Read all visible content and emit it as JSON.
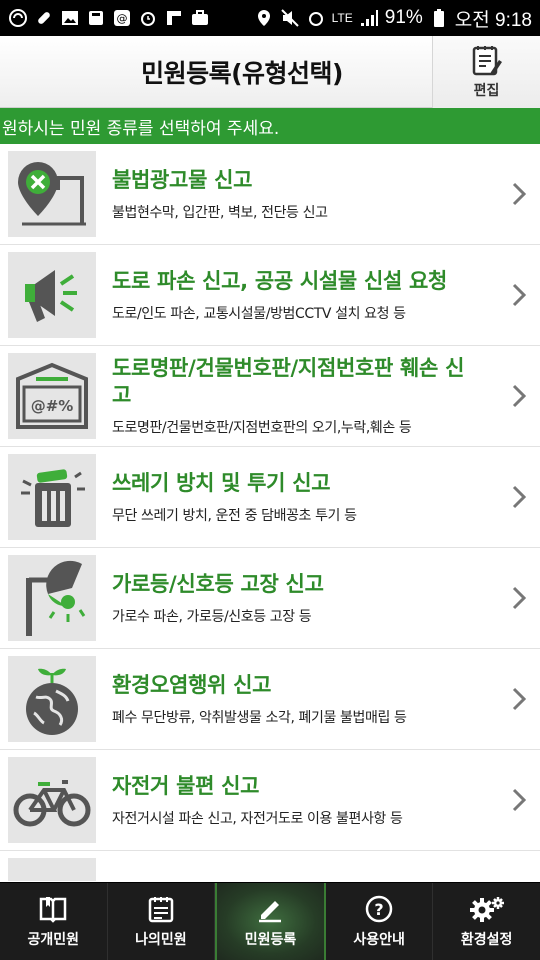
{
  "status_bar": {
    "battery": "91%",
    "time": "오전 9:18",
    "network": "LTE"
  },
  "header": {
    "title": "민원등록(유형선택)",
    "edit_label": "편집"
  },
  "banner": {
    "text": "원하시는 민원 종류를 선택하여 주세요."
  },
  "items": [
    {
      "title": "불법광고물 신고",
      "desc": "불법현수막, 입간판, 벽보, 전단등 신고",
      "icon": "ad-sign-icon"
    },
    {
      "title": "도로 파손 신고, 공공 시설물 신설 요청",
      "desc": "도로/인도 파손, 교통시설물/방범CCTV 설치 요청 등",
      "icon": "megaphone-icon"
    },
    {
      "title": "도로명판/건물번호판/지점번호판 훼손 신고",
      "desc": "도로명판/건물번호판/지점번호판의 오기,누락,훼손 등",
      "icon": "sign-plate-icon"
    },
    {
      "title": "쓰레기 방치 및 투기 신고",
      "desc": "무단 쓰레기 방치, 운전 중 담배꽁초 투기 등",
      "icon": "trash-can-icon"
    },
    {
      "title": "가로등/신호등 고장 신고",
      "desc": "가로수 파손, 가로등/신호등 고장 등",
      "icon": "street-lamp-icon"
    },
    {
      "title": "환경오염행위 신고",
      "desc": "폐수 무단방류, 악취발생물 소각, 폐기물 불법매립 등",
      "icon": "globe-sprout-icon"
    },
    {
      "title": "자전거 불편 신고",
      "desc": "자전거시설 파손 신고, 자전거도로 이용 불편사항 등",
      "icon": "bicycle-icon"
    }
  ],
  "tabs": [
    {
      "label": "공개민원",
      "icon": "book-icon",
      "active": false
    },
    {
      "label": "나의민원",
      "icon": "calendar-icon",
      "active": false
    },
    {
      "label": "민원등록",
      "icon": "pencil-icon",
      "active": true
    },
    {
      "label": "사용안내",
      "icon": "help-icon",
      "active": false
    },
    {
      "label": "환경설정",
      "icon": "gear-icon",
      "active": false
    }
  ],
  "colors": {
    "accent_green": "#2e9a33",
    "title_green": "#2e8b2a",
    "icon_gray": "#555555",
    "tabbar_bg": "#1c1c1c"
  }
}
